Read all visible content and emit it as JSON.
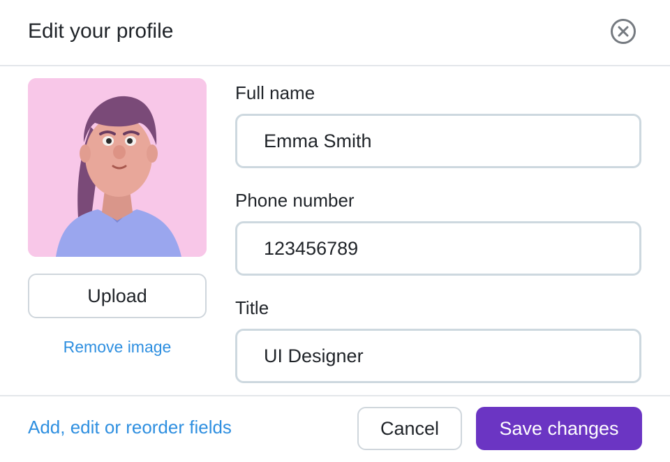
{
  "dialog": {
    "title": "Edit your profile",
    "close_icon": "close-circle-icon"
  },
  "avatar": {
    "image": "profile-avatar-woman",
    "background_color": "#f8c7e8"
  },
  "photo_actions": {
    "upload_label": "Upload",
    "remove_label": "Remove image"
  },
  "fields": {
    "full_name": {
      "label": "Full name",
      "value": "Emma Smith"
    },
    "phone": {
      "label": "Phone number",
      "value": "123456789"
    },
    "title": {
      "label": "Title",
      "value": "UI Designer"
    }
  },
  "footer": {
    "fields_link": "Add, edit or reorder fields",
    "cancel_label": "Cancel",
    "save_label": "Save changes"
  },
  "colors": {
    "accent": "#6b35c3",
    "link": "#2e8fe0",
    "border": "#cdd8df"
  }
}
